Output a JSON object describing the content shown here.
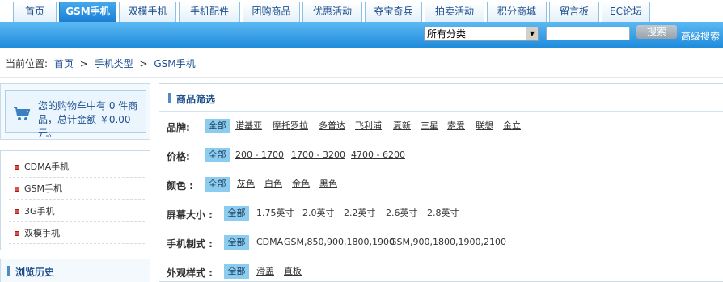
{
  "nav": {
    "tabs": [
      {
        "label": "首页"
      },
      {
        "label": "GSM手机"
      },
      {
        "label": "双模手机"
      },
      {
        "label": "手机配件"
      },
      {
        "label": "团购商品"
      },
      {
        "label": "优惠活动"
      },
      {
        "label": "夺宝奇兵"
      },
      {
        "label": "拍卖活动"
      },
      {
        "label": "积分商城"
      },
      {
        "label": "留言板"
      },
      {
        "label": "EC论坛"
      }
    ],
    "active_index": 1
  },
  "search": {
    "category_selected": "所有分类",
    "input_value": "",
    "button_label": "搜索",
    "advanced_label": "高级搜索"
  },
  "breadcrumb": {
    "prefix": "当前位置:",
    "items": [
      "首页",
      "手机类型",
      "GSM手机"
    ],
    "separator": ">"
  },
  "cart": {
    "text": "您的购物车中有 0 件商品，总计金额 ￥0.00元。"
  },
  "categories": [
    "CDMA手机",
    "GSM手机",
    "3G手机",
    "双模手机"
  ],
  "history": {
    "title": "浏览历史"
  },
  "filter": {
    "title": "商品筛选",
    "rows": [
      {
        "label": "品牌:",
        "all": "全部",
        "options": [
          "诺基亚",
          "摩托罗拉",
          "多普达",
          "飞利浦",
          "夏新",
          "三星",
          "索爱",
          "联想",
          "金立"
        ]
      },
      {
        "label": "价格:",
        "all": "全部",
        "options": [
          "200 - 1700",
          "1700 - 3200",
          "4700 - 6200"
        ]
      },
      {
        "label": "颜色 :",
        "all": "全部",
        "options": [
          "灰色",
          "白色",
          "金色",
          "黑色"
        ]
      },
      {
        "label": "屏幕大小 :",
        "all": "全部",
        "options": [
          "1.75英寸",
          "2.0英寸",
          "2.2英寸",
          "2.6英寸",
          "2.8英寸"
        ]
      },
      {
        "label": "手机制式 :",
        "all": "全部",
        "options": [
          "CDMA",
          "GSM,850,900,1800,1900",
          "GSM,900,1800,1900,2100"
        ]
      },
      {
        "label": "外观样式 :",
        "all": "全部",
        "options": [
          "滑盖",
          "直板"
        ]
      }
    ]
  },
  "colors": {
    "accent": "#1e8bdc",
    "link": "#1d4f8f",
    "all_bg": "#8ccdef"
  }
}
